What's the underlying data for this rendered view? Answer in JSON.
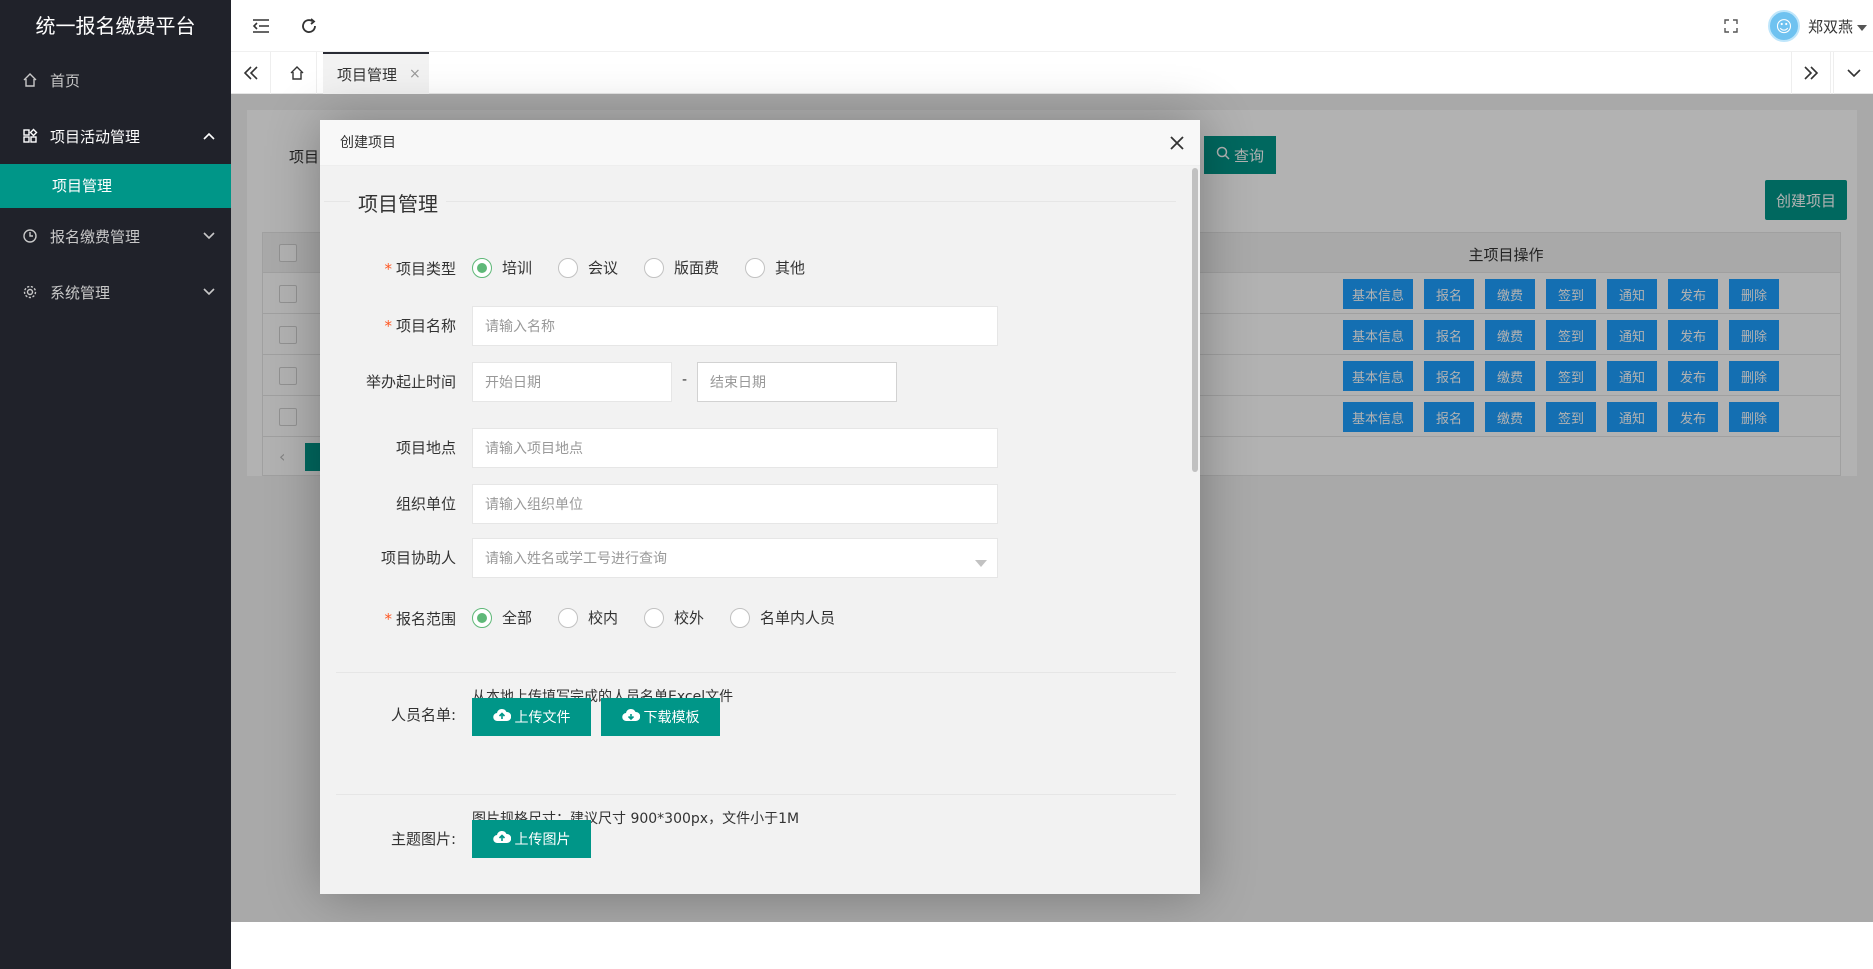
{
  "app": {
    "title": "统一报名缴费平台"
  },
  "sidebar": {
    "items": [
      {
        "label": "首页",
        "icon": "home-icon"
      },
      {
        "label": "项目活动管理",
        "icon": "apps-icon",
        "arrow": "⌃"
      },
      {
        "label": "项目管理"
      },
      {
        "label": "报名缴费管理",
        "icon": "clock-icon",
        "arrow": "⌄"
      },
      {
        "label": "系统管理",
        "icon": "gear-icon",
        "arrow": "⌄"
      }
    ]
  },
  "header": {
    "user_name": "郑双燕"
  },
  "tabs": {
    "active_label": "项目管理",
    "close": "×"
  },
  "main": {
    "search_label": "项目",
    "query_label": "查询",
    "create_label": "创建项目",
    "table": {
      "ops_header": "主项目操作",
      "row_ops": [
        "基本信息",
        "报名",
        "缴费",
        "签到",
        "通知",
        "发布",
        "删除"
      ],
      "row_count": 4
    }
  },
  "modal": {
    "title": "创建项目",
    "section_title": "项目管理",
    "fields": {
      "type_label": "项目类型",
      "type_options": [
        "培训",
        "会议",
        "版面费",
        "其他"
      ],
      "type_selected": "培训",
      "name_label": "项目名称",
      "name_placeholder": "请输入名称",
      "date_label": "举办起止时间",
      "start_placeholder": "开始日期",
      "date_sep": "-",
      "end_placeholder": "结束日期",
      "location_label": "项目地点",
      "location_placeholder": "请输入项目地点",
      "org_label": "组织单位",
      "org_placeholder": "请输入组织单位",
      "assistant_label": "项目协助人",
      "assistant_placeholder": "请输入姓名或学工号进行查询",
      "scope_label": "报名范围",
      "scope_options": [
        "全部",
        "校内",
        "校外",
        "名单内人员"
      ],
      "scope_selected": "全部",
      "list_label": "人员名单:",
      "list_hint": "从本地上传填写完成的人员名单Excel文件",
      "upload_file": "上传文件",
      "download_template": "下载模板",
      "image_label": "主题图片:",
      "image_hint": "图片规格尺寸：建议尺寸 900*300px，文件小于1M",
      "upload_image": "上传图片"
    }
  },
  "colors": {
    "primary": "#009688",
    "op_blue": "#1e9fff",
    "sidebar": "#20222a",
    "radio_on": "#5fb878",
    "required": "#ff5722"
  }
}
